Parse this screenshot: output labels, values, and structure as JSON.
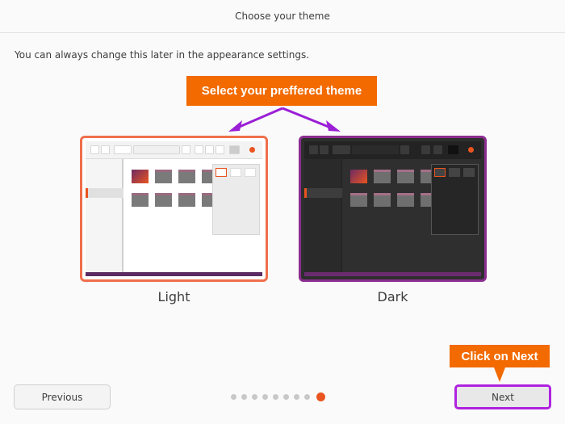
{
  "header": {
    "title": "Choose your theme"
  },
  "subtitle": "You can always change this later in the appearance settings.",
  "annotations": {
    "top_callout": "Select your preffered theme",
    "next_callout": "Click on Next",
    "callout_color": "#f26a00",
    "arrow_color": "#9b1fd6"
  },
  "themes": [
    {
      "label": "Light",
      "selected": true,
      "border_color": "#ef6f4c"
    },
    {
      "label": "Dark",
      "selected": false,
      "border_color": "#8b2d8f"
    }
  ],
  "navigation": {
    "previous_label": "Previous",
    "next_label": "Next",
    "page_count": 9,
    "current_page": 9
  },
  "accent_color": "#e9541f"
}
